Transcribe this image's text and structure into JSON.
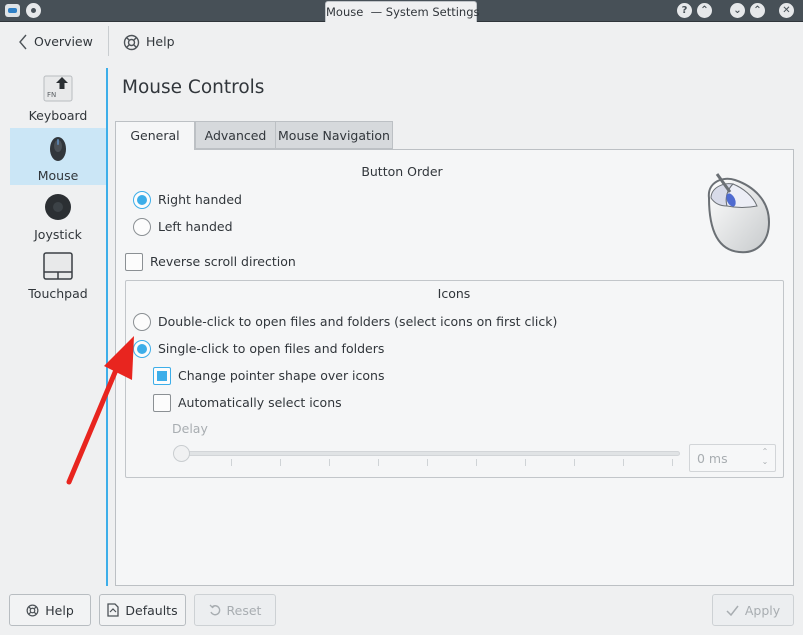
{
  "window": {
    "title_app": "Mouse",
    "title_rest": "— System Settings"
  },
  "toolbar": {
    "overview_label": "Overview",
    "help_label": "Help"
  },
  "sidebar": {
    "items": [
      {
        "label": "Keyboard",
        "icon": "keyboard-icon",
        "active": false
      },
      {
        "label": "Mouse",
        "icon": "mouse-icon",
        "active": true
      },
      {
        "label": "Joystick",
        "icon": "joystick-icon",
        "active": false
      },
      {
        "label": "Touchpad",
        "icon": "touchpad-icon",
        "active": false
      }
    ],
    "keyboard_key_text": "FN"
  },
  "page": {
    "title": "Mouse Controls",
    "tabs": [
      {
        "label": "General",
        "active": true
      },
      {
        "label": "Advanced",
        "active": false
      },
      {
        "label": "Mouse Navigation",
        "active": false
      }
    ]
  },
  "button_order": {
    "title": "Button Order",
    "right_handed": {
      "label": "Right handed",
      "checked": true
    },
    "left_handed": {
      "label": "Left handed",
      "checked": false
    },
    "reverse_scroll": {
      "label": "Reverse scroll direction",
      "checked": false
    }
  },
  "icons_group": {
    "title": "Icons",
    "double_click": {
      "label": "Double-click to open files and folders (select icons on first click)",
      "checked": false
    },
    "single_click": {
      "label": "Single-click to open files and folders",
      "checked": true
    },
    "change_pointer": {
      "label": "Change pointer shape over icons",
      "checked": true
    },
    "auto_select": {
      "label": "Automatically select icons",
      "checked": false
    },
    "delay_label": "Delay",
    "delay_value": "0 ms"
  },
  "buttons": {
    "help": "Help",
    "defaults": "Defaults",
    "reset": "Reset",
    "apply": "Apply"
  },
  "colors": {
    "accent": "#3daee9",
    "annotation_arrow": "#e8251f",
    "titlebar": "#475057"
  }
}
